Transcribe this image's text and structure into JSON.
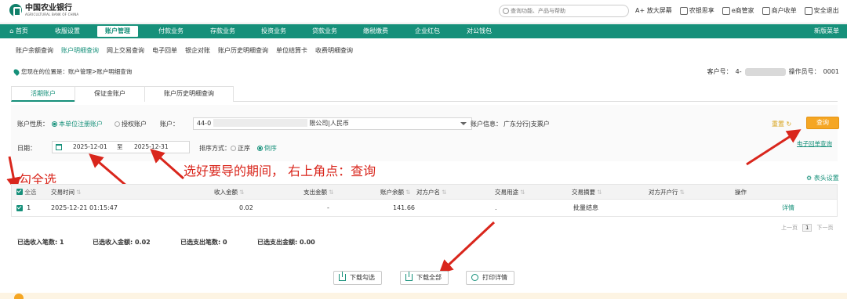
{
  "brand": {
    "name": "中国农业银行",
    "name_en": "AGRICULTURAL BANK OF CHINA"
  },
  "search": {
    "placeholder": "查询功能、产品与帮助"
  },
  "top_links": [
    {
      "label": "A+ 放大屏幕"
    },
    {
      "label": "农银思享"
    },
    {
      "label": "e商管家"
    },
    {
      "label": "商户收单"
    },
    {
      "label": "安全退出"
    }
  ],
  "main_nav": {
    "items": [
      "首页",
      "收服设置",
      "账户管理",
      "付款业务",
      "存款业务",
      "投资业务",
      "贷款业务",
      "缴税缴费",
      "企业红包",
      "对公钱包"
    ],
    "active": "账户管理",
    "right": "新版菜单"
  },
  "sub_nav": {
    "items": [
      "账户余额查询",
      "账户明细查询",
      "网上交易查询",
      "电子回单",
      "银企对账",
      "账户历史明细查询",
      "单位结算卡",
      "收费明细查询"
    ],
    "active": "账户明细查询"
  },
  "breadcrumb": "您现在的位置是：账户管理>账户明细查询",
  "account": {
    "customer_label": "客户号：",
    "customer_no": "4-",
    "operator_label": "操作员号：",
    "operator_no": "0001"
  },
  "tabs": [
    "活期账户",
    "保证金账户",
    "账户历史明细查询"
  ],
  "filters": {
    "acct_type_label": "账户性质：",
    "acct_type_opt1": "本单位注册账户",
    "acct_type_opt2": "授权账户",
    "acct_label": "账户：",
    "acct_value_prefix": "44-0",
    "acct_value_suffix": "限公司|人民币",
    "acct_info_label": "账户信息：",
    "acct_info_value": "广东分行|支票户",
    "date_label": "日期：",
    "date_from": "2025-12-01",
    "date_sep": "至",
    "date_to": "2025-12-31",
    "sort_label": "排序方式：",
    "sort_opt1": "正序",
    "sort_opt2": "倒序",
    "reset_label": "重置",
    "query_label": "查询",
    "ereceipt_label": "电子回单查询"
  },
  "annotations": {
    "check_all": "勾全选",
    "period_query": "选好要导的期间， 右上角点：查询"
  },
  "table": {
    "column_setting": "表头设置",
    "headers": [
      "全选",
      "交易时间",
      "收入金额",
      "支出金额",
      "账户余额",
      "对方户名",
      "交易用途",
      "交易摘要",
      "对方开户行",
      "操作"
    ],
    "rows": [
      {
        "index": "1",
        "time": "2025-12-21 01:15:47",
        "income": "0.02",
        "expense": "-",
        "balance": "141.66",
        "counterparty": "",
        "purpose": ".",
        "summary": "批量结息",
        "bank": "",
        "action": "详情"
      }
    ]
  },
  "pagination": {
    "prev": "上一页",
    "current": "1",
    "next": "下一页"
  },
  "summary": {
    "income_count": "已选收入笔数: 1",
    "income_amount": "已选收入金额: 0.02",
    "expense_count": "已选支出笔数: 0",
    "expense_amount": "已选支出金额: 0.00"
  },
  "buttons": {
    "download_selected": "下载勾选",
    "download_all": "下载全部",
    "print_detail": "打印详情"
  },
  "colors": {
    "brand_green": "#16907a",
    "query_orange": "#f5a623",
    "annotation_red": "#d9261c"
  }
}
